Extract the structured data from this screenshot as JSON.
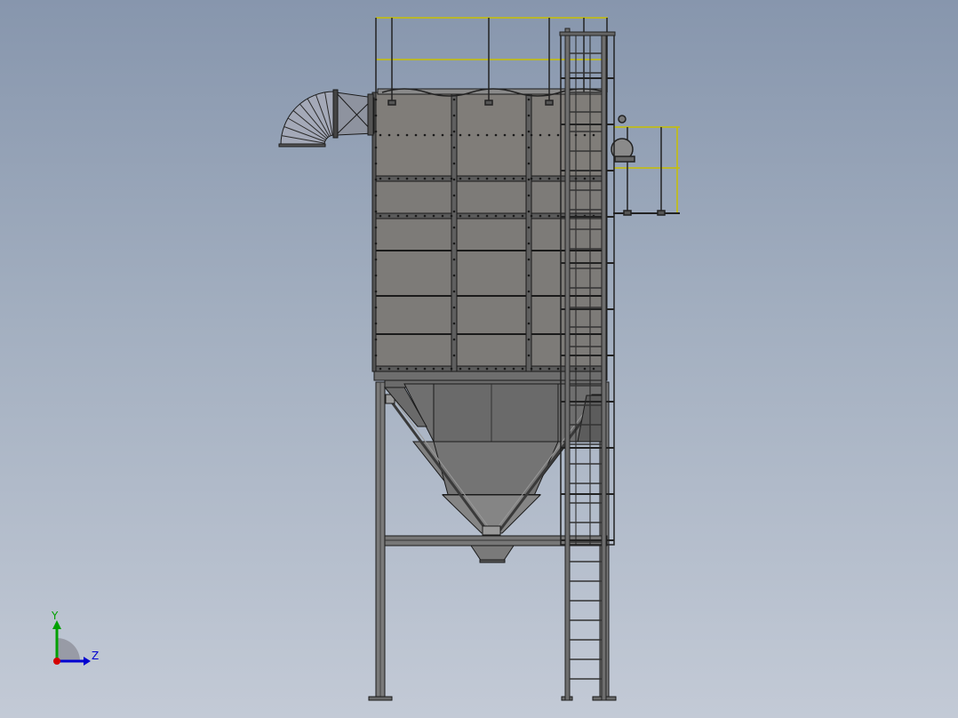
{
  "colors": {
    "background_top": "#8796ad",
    "background_bottom": "#c3cad6",
    "steel": "#767676",
    "steel_light": "#8c8a88",
    "steel_dark": "#5e5e5e",
    "edge": "#1a1a1a",
    "railing": "#d8d000",
    "duct": "#9aa0b0",
    "axis_x": "#d40000",
    "axis_y": "#00a000",
    "axis_z": "#0000d0"
  },
  "triad": {
    "y_label": "Y",
    "z_label": "Z"
  },
  "model": {
    "name_icon": "dust-collector-model"
  }
}
